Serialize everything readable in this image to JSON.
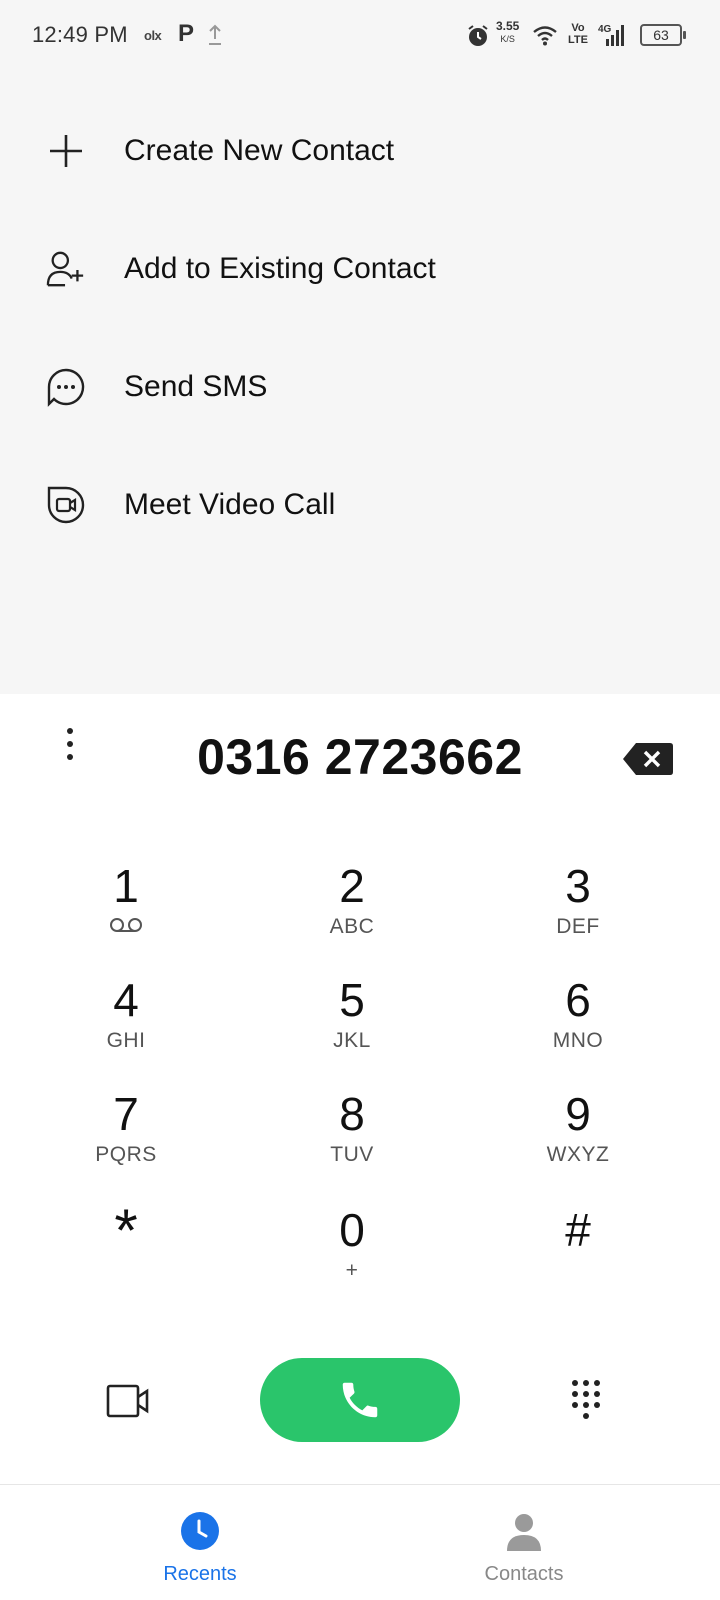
{
  "status_bar": {
    "time": "12:49 PM",
    "olx": "olx",
    "p_app": "P",
    "speed_value": "3.55",
    "speed_unit": "K/S",
    "volte_top": "Vo",
    "volte_bottom": "LTE",
    "network": "4G",
    "battery": "63",
    "icons": [
      "olx-icon",
      "p-app-icon",
      "upload-icon",
      "alarm-icon",
      "wifi-icon",
      "signal-icon",
      "battery-icon"
    ]
  },
  "actions": [
    {
      "label": "Create New Contact",
      "icon": "plus-icon"
    },
    {
      "label": "Add to Existing Contact",
      "icon": "add-person-icon"
    },
    {
      "label": "Send SMS",
      "icon": "message-icon"
    },
    {
      "label": "Meet Video Call",
      "icon": "meet-video-icon"
    }
  ],
  "dialer": {
    "number": "0316 2723662"
  },
  "keypad": [
    {
      "digit": "1",
      "letters": ""
    },
    {
      "digit": "2",
      "letters": "ABC"
    },
    {
      "digit": "3",
      "letters": "DEF"
    },
    {
      "digit": "4",
      "letters": "GHI"
    },
    {
      "digit": "5",
      "letters": "JKL"
    },
    {
      "digit": "6",
      "letters": "MNO"
    },
    {
      "digit": "7",
      "letters": "PQRS"
    },
    {
      "digit": "8",
      "letters": "TUV"
    },
    {
      "digit": "9",
      "letters": "WXYZ"
    },
    {
      "digit": "*",
      "letters": ""
    },
    {
      "digit": "0",
      "letters": "+"
    },
    {
      "digit": "#",
      "letters": ""
    }
  ],
  "nav": {
    "recents": "Recents",
    "contacts": "Contacts"
  },
  "colors": {
    "accent": "#1a73e8",
    "call_green": "#2ac56b",
    "top_background": "#f6f6f6",
    "inactive_nav": "#888888"
  }
}
